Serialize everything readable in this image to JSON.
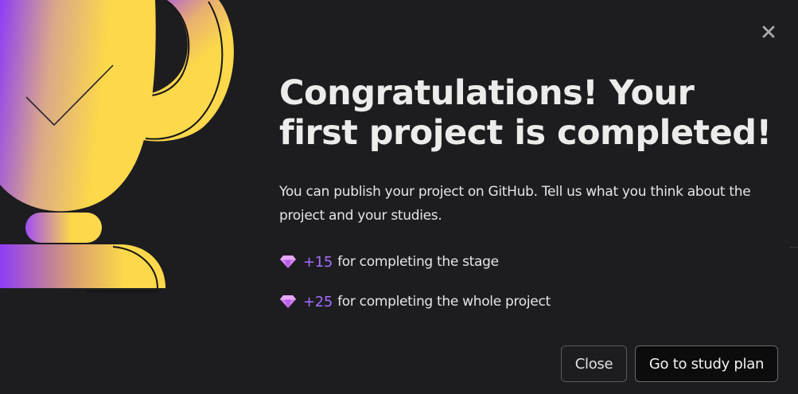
{
  "dialog": {
    "title": "Congratulations! Your first project is completed!",
    "description": "You can publish your project on GitHub. Tell us what you think about the project and your studies.",
    "close_icon": "close-icon",
    "illustration_icon": "trophy-icon",
    "rewards": [
      {
        "icon": "gem-icon",
        "points": "+15",
        "text": "for completing the stage"
      },
      {
        "icon": "gem-icon",
        "points": "+25",
        "text": "for completing the whole project"
      }
    ],
    "buttons": {
      "close_label": "Close",
      "study_plan_label": "Go to study plan"
    }
  },
  "colors": {
    "background": "#1d1d20",
    "accent_purple": "#a56bff",
    "trophy_yellow": "#fcd84a",
    "trophy_purple": "#8e3cf7"
  }
}
